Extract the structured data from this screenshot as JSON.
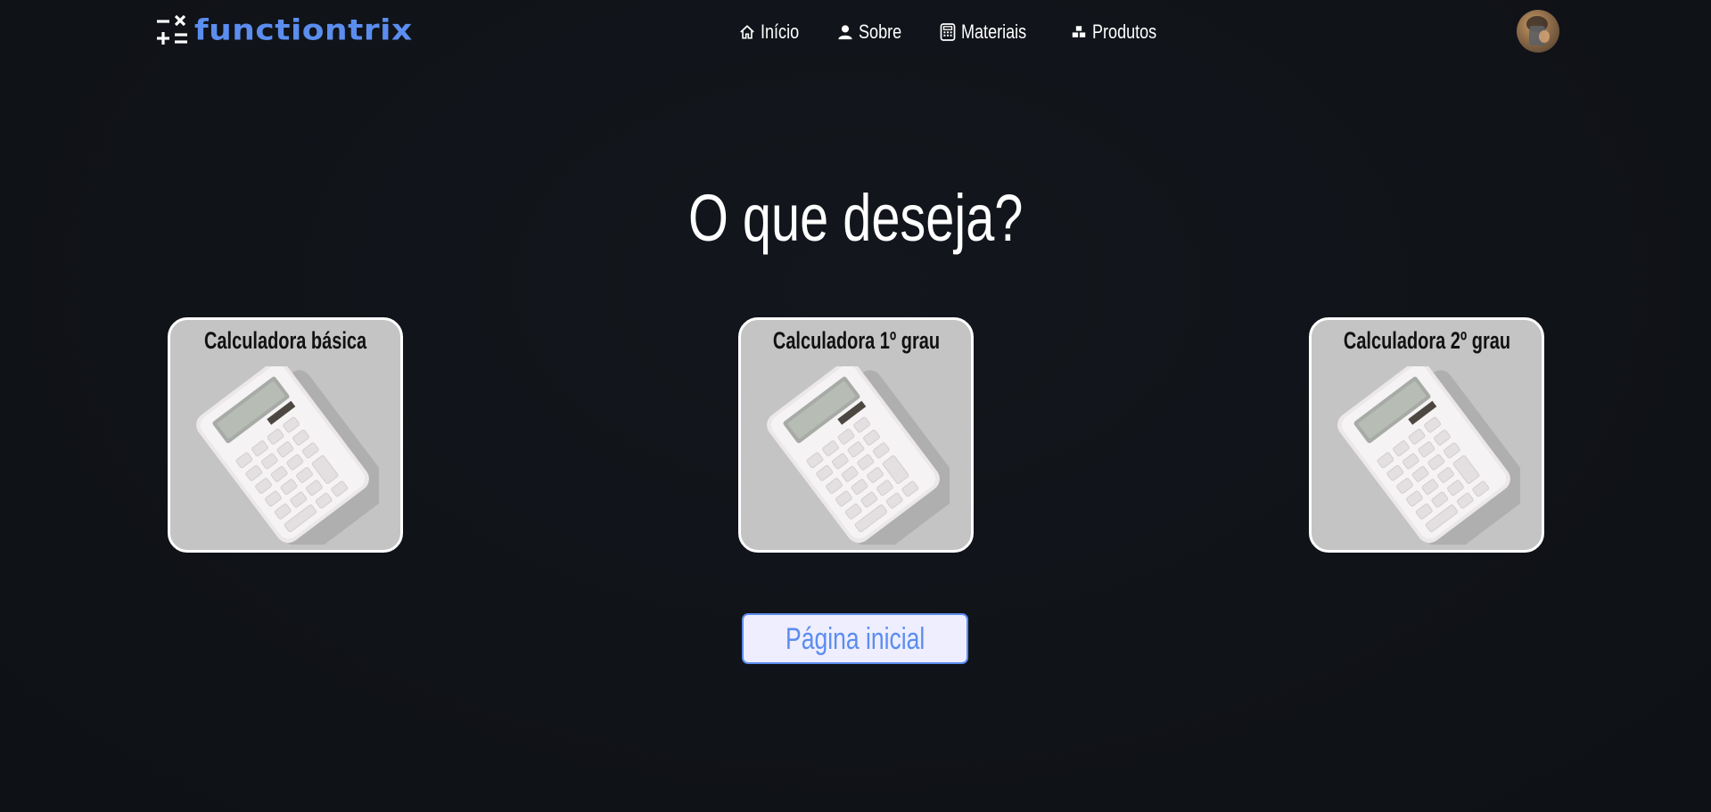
{
  "header": {
    "brand": "functiontrix",
    "nav": [
      {
        "label": "Início",
        "icon": "home-icon"
      },
      {
        "label": "Sobre",
        "icon": "user-icon"
      },
      {
        "label": "Materiais",
        "icon": "calculator-icon"
      },
      {
        "label": "Produtos",
        "icon": "boxes-icon"
      }
    ],
    "avatar_icon": "user-avatar"
  },
  "main": {
    "title": "O que deseja?",
    "cards": [
      {
        "label": "Calculadora básica",
        "image": "calculator-photo"
      },
      {
        "label": "Calculadora 1º grau",
        "image": "calculator-photo"
      },
      {
        "label": "Calculadora 2º grau",
        "image": "calculator-photo"
      }
    ],
    "home_button": "Página inicial"
  },
  "colors": {
    "background": "#101318",
    "brand_blue": "#5b8def",
    "button_bg": "#eeeeff",
    "card_border": "#ffffff"
  }
}
